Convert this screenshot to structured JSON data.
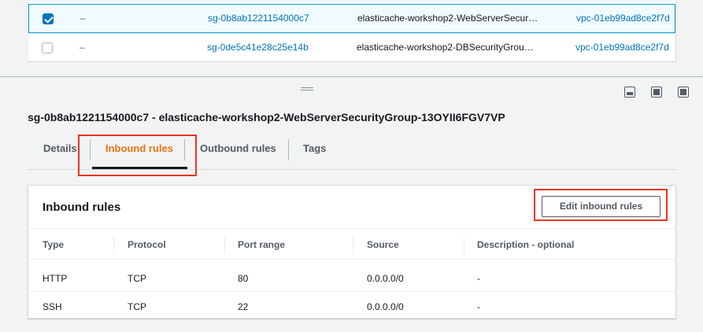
{
  "security_groups": [
    {
      "selected": true,
      "name": "–",
      "group_id": "sg-0b8ab1221154000c7",
      "group_name": "elasticache-workshop2-WebServerSecur…",
      "vpc_id": "vpc-01eb99ad8ce2f7d"
    },
    {
      "selected": false,
      "name": "–",
      "group_id": "sg-0de5c41e28c25e14b",
      "group_name": "elasticache-workshop2-DBSecurityGrou…",
      "vpc_id": "vpc-01eb99ad8ce2f7d"
    }
  ],
  "detail": {
    "title": "sg-0b8ab1221154000c7 - elasticache-workshop2-WebServerSecurityGroup-13OYII6FGV7VP",
    "tabs": [
      {
        "label": "Details"
      },
      {
        "label": "Inbound rules",
        "active": true
      },
      {
        "label": "Outbound rules"
      },
      {
        "label": "Tags"
      }
    ]
  },
  "inbound": {
    "title": "Inbound rules",
    "edit_label": "Edit inbound rules",
    "columns": [
      "Type",
      "Protocol",
      "Port range",
      "Source",
      "Description - optional"
    ],
    "rows": [
      [
        "HTTP",
        "TCP",
        "80",
        "0.0.0.0/0",
        "-"
      ],
      [
        "SSH",
        "TCP",
        "22",
        "0.0.0.0/0",
        "-"
      ]
    ]
  },
  "colors": {
    "accent": "#ec7211",
    "link": "#0073bb",
    "highlight": "#e8351f"
  }
}
